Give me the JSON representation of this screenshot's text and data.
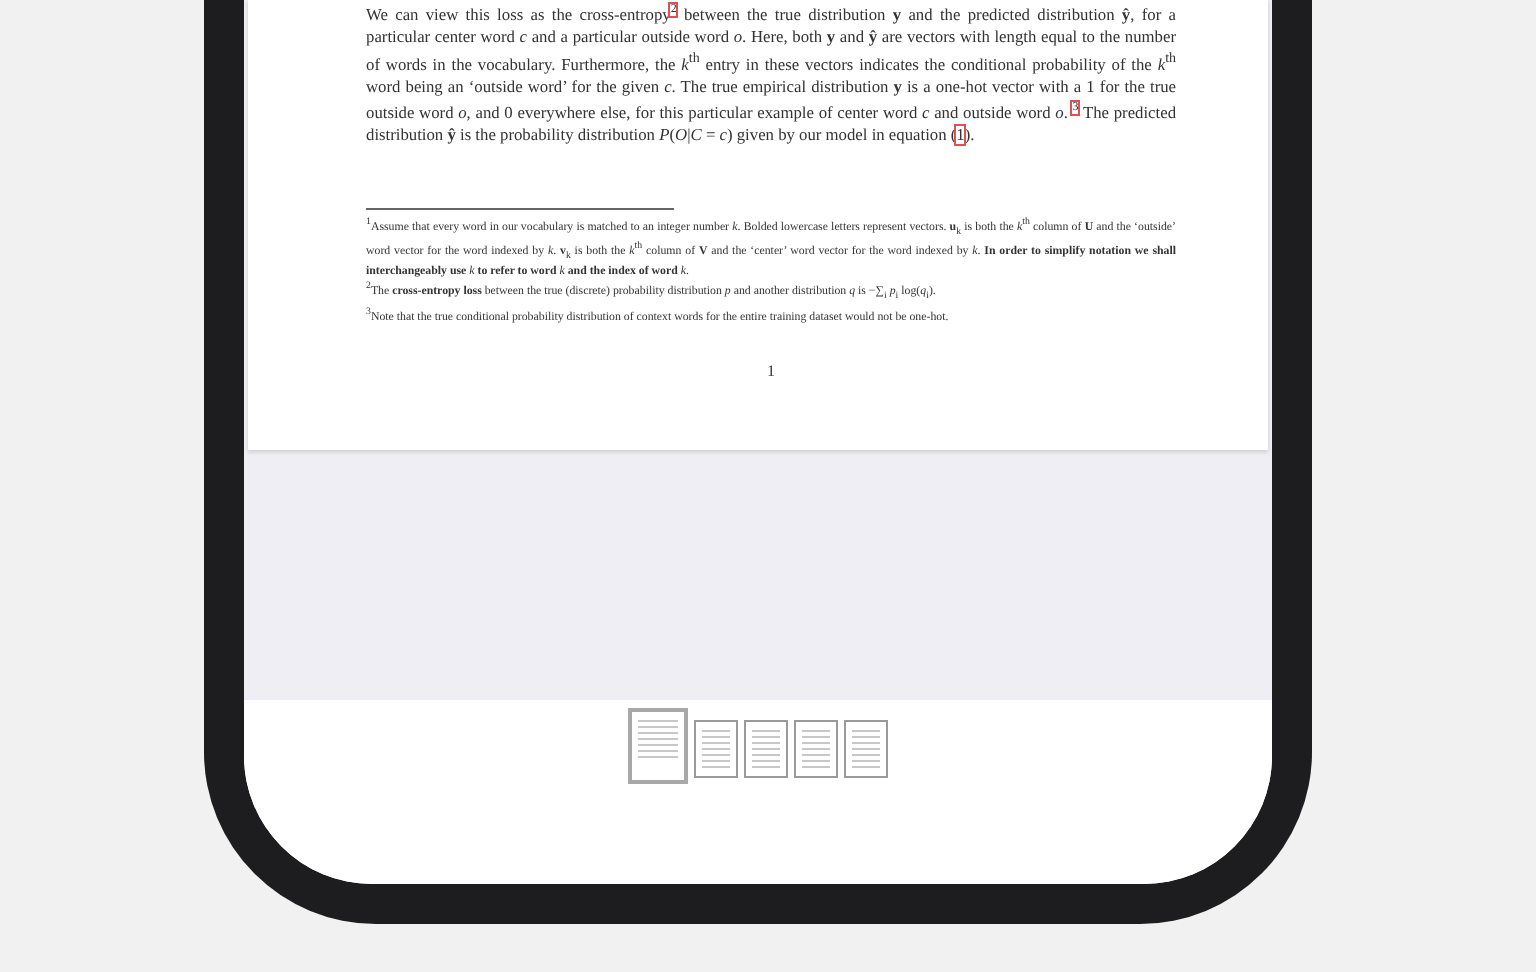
{
  "page": {
    "paragraph": [
      {
        "kind": "text",
        "text": "We can view this loss as the cross-entropy"
      },
      {
        "kind": "ref",
        "text": "2",
        "raised": true
      },
      {
        "kind": "text",
        "text": " between the true distribution **y** and the predicted distribution **ŷ**, for a particular center word *c* and a particular outside word *o*. Here, both **y** and **ŷ** are vectors with length equal to the number of words in the vocabulary. Furthermore, the *k*$^{th}$ entry in these vectors indicates the conditional probability of the *k*$^{th}$ word being an ‘outside word’ for the given *c*. The true empirical distribution **y** is a one-hot vector with a 1 for the true outside word *o*, and 0 everywhere else, for this particular example of center word *c* and outside word *o*. "
      },
      {
        "kind": "ref",
        "text": "3",
        "raised": true
      },
      {
        "kind": "text",
        "text": " The predicted distribution **ŷ** is the probability distribution *P*(*O*|*C* = *c*) given by our model in equation ("
      },
      {
        "kind": "ref",
        "text": "1",
        "raised": false
      },
      {
        "kind": "text",
        "text": ")."
      }
    ],
    "footnotes": [
      {
        "mark": "1",
        "text": "Assume that every word in our vocabulary is matched to an integer number *k*. Bolded lowercase letters represent vectors. **u**$_{k}$ is both the *k*$^{th}$ column of **U** and the ‘outside’ word vector for the word indexed by *k*. **v**$_{k}$ is both the *k*$^{th}$ column of **V** and the ‘center’ word vector for the word indexed by *k*. **In order to simplify notation we shall interchangeably use** *k* **to refer to word** *k* **and the index of word** *k*."
      },
      {
        "mark": "2",
        "text": "The **cross-entropy loss** between the true (discrete) probability distribution *p* and another distribution *q* is −∑$_{i}$ *p*$_{i}$ log(*q*$_{i}$)."
      },
      {
        "mark": "3",
        "text": "Note that the true conditional probability distribution of context words for the entire training dataset would not be one-hot."
      }
    ],
    "page_number": "1"
  },
  "thumbnails": [
    {
      "selected": true
    },
    {
      "selected": false
    },
    {
      "selected": false
    },
    {
      "selected": false
    },
    {
      "selected": false
    }
  ]
}
